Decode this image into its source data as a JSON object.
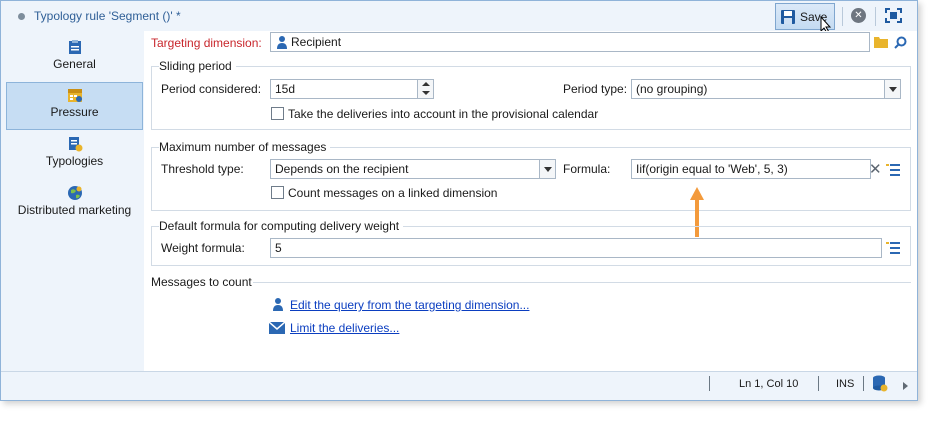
{
  "window": {
    "title": "Typology rule 'Segment ()' *"
  },
  "toolbar": {
    "save_label": "Save",
    "cancel_icon": "close-circle-icon",
    "fullscreen_icon": "fullscreen-icon"
  },
  "sidebar": {
    "items": [
      {
        "label": "General",
        "icon": "clipboard-icon",
        "active": false
      },
      {
        "label": "Pressure",
        "icon": "calendar-icon",
        "active": true
      },
      {
        "label": "Typologies",
        "icon": "typology-icon",
        "active": false
      },
      {
        "label": "Distributed marketing",
        "icon": "globe-icon",
        "active": false
      }
    ]
  },
  "targeting": {
    "label": "Targeting dimension:",
    "value": "Recipient"
  },
  "sliding_period": {
    "legend": "Sliding period",
    "period_label": "Period considered:",
    "period_value": "15d",
    "period_type_label": "Period type:",
    "period_type_value": "(no grouping)",
    "calendar_checkbox_label": "Take the deliveries into account in the provisional calendar"
  },
  "max_messages": {
    "legend": "Maximum number of messages",
    "threshold_label": "Threshold type:",
    "threshold_value": "Depends on the recipient",
    "formula_label": "Formula:",
    "formula_value": "Iif(origin equal to 'Web', 5, 3)",
    "linked_checkbox_label": "Count messages on a linked dimension"
  },
  "weight": {
    "legend": "Default formula for computing delivery weight",
    "weight_label": "Weight formula:",
    "weight_value": "5"
  },
  "messages_to_count": {
    "legend": "Messages to count",
    "edit_query_link": "Edit the query from the targeting dimension...",
    "limit_link": "Limit the deliveries..."
  },
  "statusbar": {
    "position": "Ln 1, Col 10",
    "mode": "INS"
  },
  "colors": {
    "accent": "#2f5f97",
    "required_label": "#c8262c",
    "link": "#0b3ec0",
    "arrow": "#f39a3c"
  }
}
